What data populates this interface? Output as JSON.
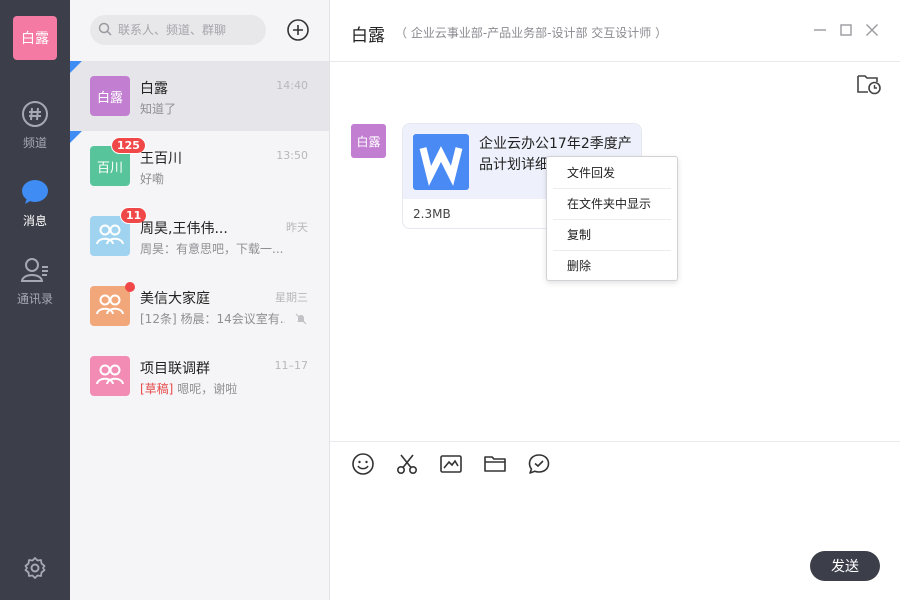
{
  "colors": {
    "rail_bg": "#3c3f4a",
    "accent_blue": "#3f8cf5",
    "badge_red": "#f04848",
    "avatar_me": "#f47aa4"
  },
  "rail": {
    "me_avatar": "白露",
    "items": [
      {
        "label": "频道",
        "icon": "hash-icon",
        "active": false
      },
      {
        "label": "消息",
        "icon": "chat-bubble-icon",
        "active": true
      },
      {
        "label": "通讯录",
        "icon": "contacts-icon",
        "active": false
      }
    ],
    "settings_icon": "gear-icon"
  },
  "search": {
    "placeholder": "联系人、频道、群聊"
  },
  "conversations": [
    {
      "avatar_text": "白露",
      "avatar_color": "#c27fd1",
      "name": "白露",
      "time": "14:40",
      "snippet": "知道了",
      "pinned": true,
      "selected": true
    },
    {
      "avatar_text": "百川",
      "avatar_color": "#58c49b",
      "name": "王百川",
      "time": "13:50",
      "snippet": "好嘞",
      "badge": "125",
      "pinned": true
    },
    {
      "avatar_icon": "group-icon",
      "avatar_color": "#9fd3ef",
      "name": "周昊,王伟伟...",
      "time": "昨天",
      "snippet": "周昊：有意思吧，下载一...",
      "badge": "11"
    },
    {
      "avatar_icon": "group-icon",
      "avatar_color": "#f2a77a",
      "name": "美信大家庭",
      "time": "星期三",
      "snippet": "[12条] 杨晨：14会议室有...",
      "dot": true,
      "muted": true
    },
    {
      "avatar_icon": "group-icon",
      "avatar_color": "#f28cb5",
      "name": "项目联调群",
      "time": "11–17",
      "draft_tag": "[草稿]",
      "snippet": "嗯呢，谢啦"
    }
  ],
  "chat": {
    "title": "白露",
    "subtitle": "（ 企业云事业部-产品业务部-设计部 交互设计师 ）",
    "message": {
      "sender_avatar": "白露",
      "file_name": "企业云办公17年2季度产品计划详细",
      "file_icon": "word-file-icon",
      "file_size": "2.3MB"
    },
    "context_menu": [
      "文件回发",
      "在文件夹中显示",
      "复制",
      "删除"
    ],
    "toolbar": [
      "emoji-icon",
      "scissors-icon",
      "image-icon",
      "folder-icon",
      "chat-check-icon"
    ],
    "send_label": "发送"
  }
}
